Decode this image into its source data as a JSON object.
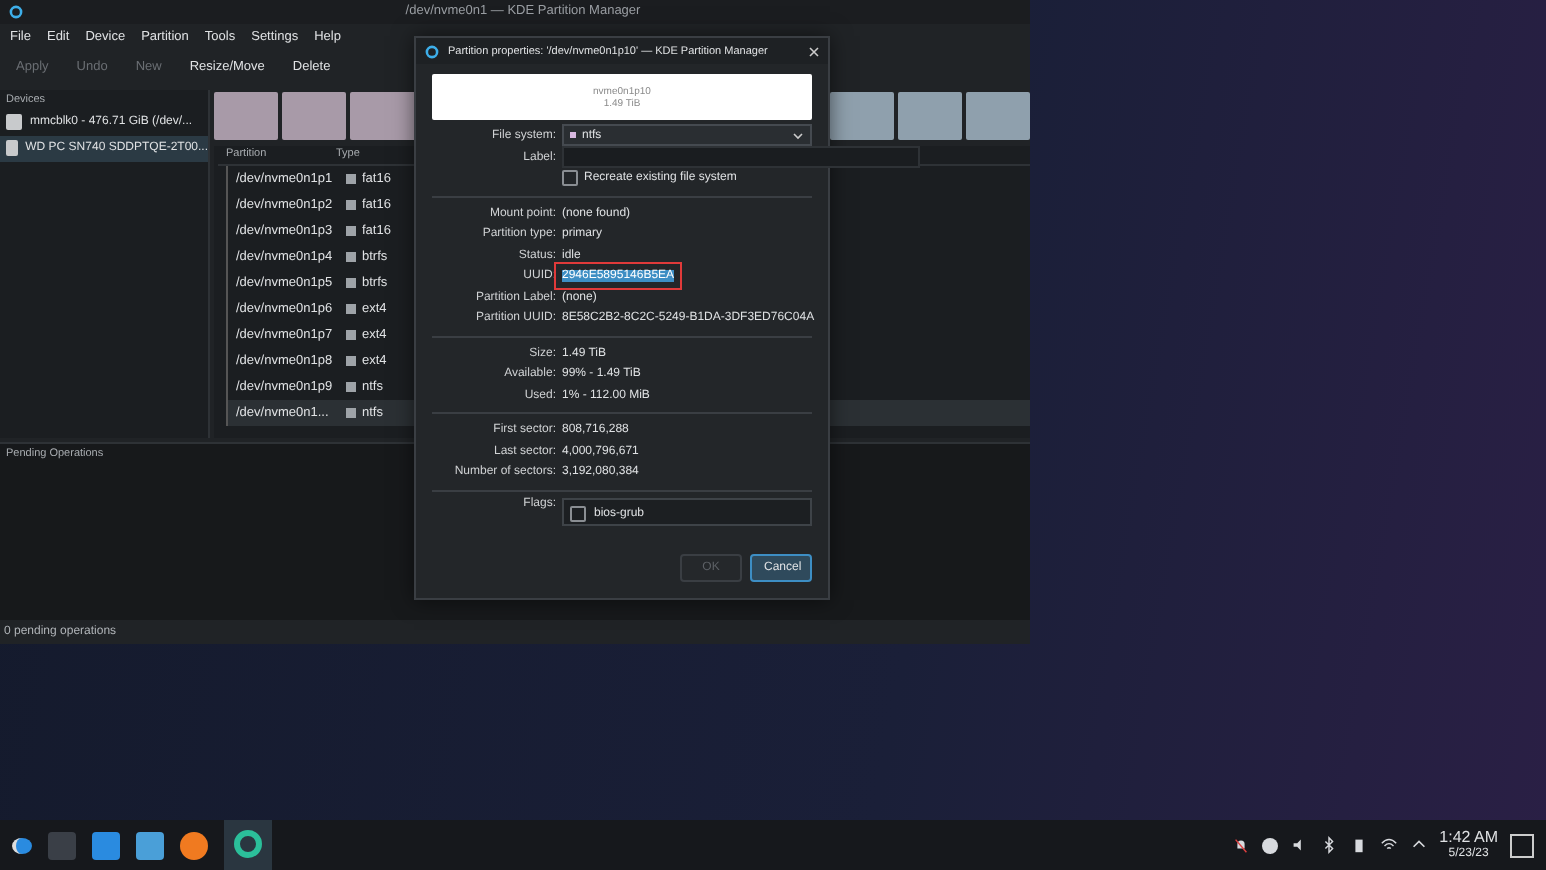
{
  "main_window": {
    "title": "/dev/nvme0n1 — KDE Partition Manager",
    "menu": [
      "File",
      "Edit",
      "Device",
      "Partition",
      "Tools",
      "Settings",
      "Help"
    ],
    "toolbar": [
      {
        "label": "Apply",
        "disabled": true
      },
      {
        "label": "Undo",
        "disabled": true
      },
      {
        "label": "New",
        "disabled": true
      },
      {
        "label": "Resize/Move",
        "disabled": false
      },
      {
        "label": "Delete",
        "disabled": false
      }
    ],
    "devices": {
      "title": "Devices",
      "items": [
        {
          "label": "mmcblk0 - 476.71 GiB (/dev/...",
          "selected": false
        },
        {
          "label": "WD PC SN740 SDDPTQE-2T00...",
          "selected": true
        }
      ]
    },
    "partitions": {
      "columns": [
        "Partition",
        "Type"
      ],
      "rows": [
        {
          "partition": "/dev/nvme0n1p1",
          "type": "fat16",
          "selected": false
        },
        {
          "partition": "/dev/nvme0n1p2",
          "type": "fat16",
          "selected": false
        },
        {
          "partition": "/dev/nvme0n1p3",
          "type": "fat16",
          "selected": false
        },
        {
          "partition": "/dev/nvme0n1p4",
          "type": "btrfs",
          "selected": false
        },
        {
          "partition": "/dev/nvme0n1p5",
          "type": "btrfs",
          "selected": false
        },
        {
          "partition": "/dev/nvme0n1p6",
          "type": "ext4",
          "selected": false
        },
        {
          "partition": "/dev/nvme0n1p7",
          "type": "ext4",
          "selected": false
        },
        {
          "partition": "/dev/nvme0n1p8",
          "type": "ext4",
          "selected": false
        },
        {
          "partition": "/dev/nvme0n1p9",
          "type": "ntfs",
          "selected": false
        },
        {
          "partition": "/dev/nvme0n1...",
          "type": "ntfs",
          "selected": true
        }
      ]
    },
    "pending_operations": {
      "title": "Pending Operations"
    },
    "status_bar": "0 pending operations"
  },
  "dialog": {
    "title": "Partition properties: '/dev/nvme0n1p10' — KDE Partition Manager",
    "preview": {
      "name": "nvme0n1p10",
      "size": "1.49 TiB"
    },
    "file_system": "ntfs",
    "label_field": "Label:",
    "file_system_label": "File system:",
    "recreate": {
      "label": "Recreate existing file system",
      "checked": false
    },
    "groups": [
      [
        {
          "label": "Mount point:",
          "value": "(none found)",
          "highlighted": false
        },
        {
          "label": "Partition type:",
          "value": "primary",
          "highlighted": false
        },
        {
          "label": "Status:",
          "value": "idle",
          "highlighted": false
        },
        {
          "label": "UUID:",
          "value": "2946E5895146B5EA",
          "highlighted": true
        },
        {
          "label": "Partition Label:",
          "value": "(none)",
          "highlighted": false
        },
        {
          "label": "Partition UUID:",
          "value": "8E58C2B2-8C2C-5249-B1DA-3DF3ED76C04A",
          "highlighted": false
        }
      ],
      [
        {
          "label": "Size:",
          "value": "1.49 TiB",
          "highlighted": false
        },
        {
          "label": "Available:",
          "value": "99% - 1.49 TiB",
          "highlighted": false
        },
        {
          "label": "Used:",
          "value": "1% - 112.00 MiB",
          "highlighted": false
        }
      ],
      [
        {
          "label": "First sector:",
          "value": "808,716,288",
          "highlighted": false
        },
        {
          "label": "Last sector:",
          "value": "4,000,796,671",
          "highlighted": false
        },
        {
          "label": "Number of sectors:",
          "value": "3,192,080,384",
          "highlighted": false
        }
      ]
    ],
    "flags_label": "Flags:",
    "flags": [
      {
        "label": "bios-grub",
        "checked": false
      }
    ],
    "buttons": [
      {
        "label": "OK",
        "disabled": true
      },
      {
        "label": "Cancel",
        "disabled": false
      }
    ]
  },
  "taskbar": {
    "time": "1:42 AM",
    "date": "5/23/23"
  }
}
